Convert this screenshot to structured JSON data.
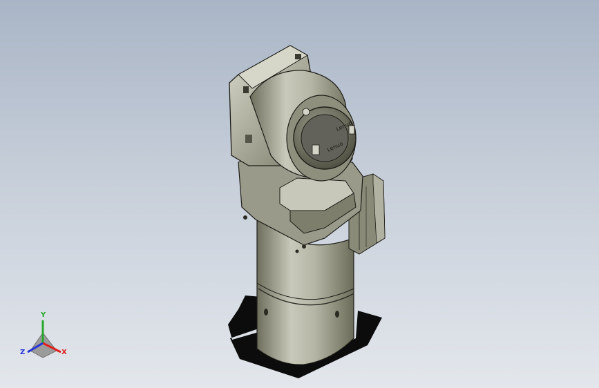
{
  "model": {
    "cap_text_top": "Lenuo",
    "cap_text_side": "Lenuo"
  },
  "triad": {
    "x_label": "X",
    "y_label": "Y",
    "z_label": "Z",
    "x_color": "#e0201c",
    "y_color": "#27a82a",
    "z_color": "#2233d8"
  },
  "colors": {
    "body": "#a7a797",
    "body_dark": "#72725f",
    "body_light": "#d3d3c5",
    "edge": "#1c1c17",
    "shadow": "#0b0b0b"
  }
}
